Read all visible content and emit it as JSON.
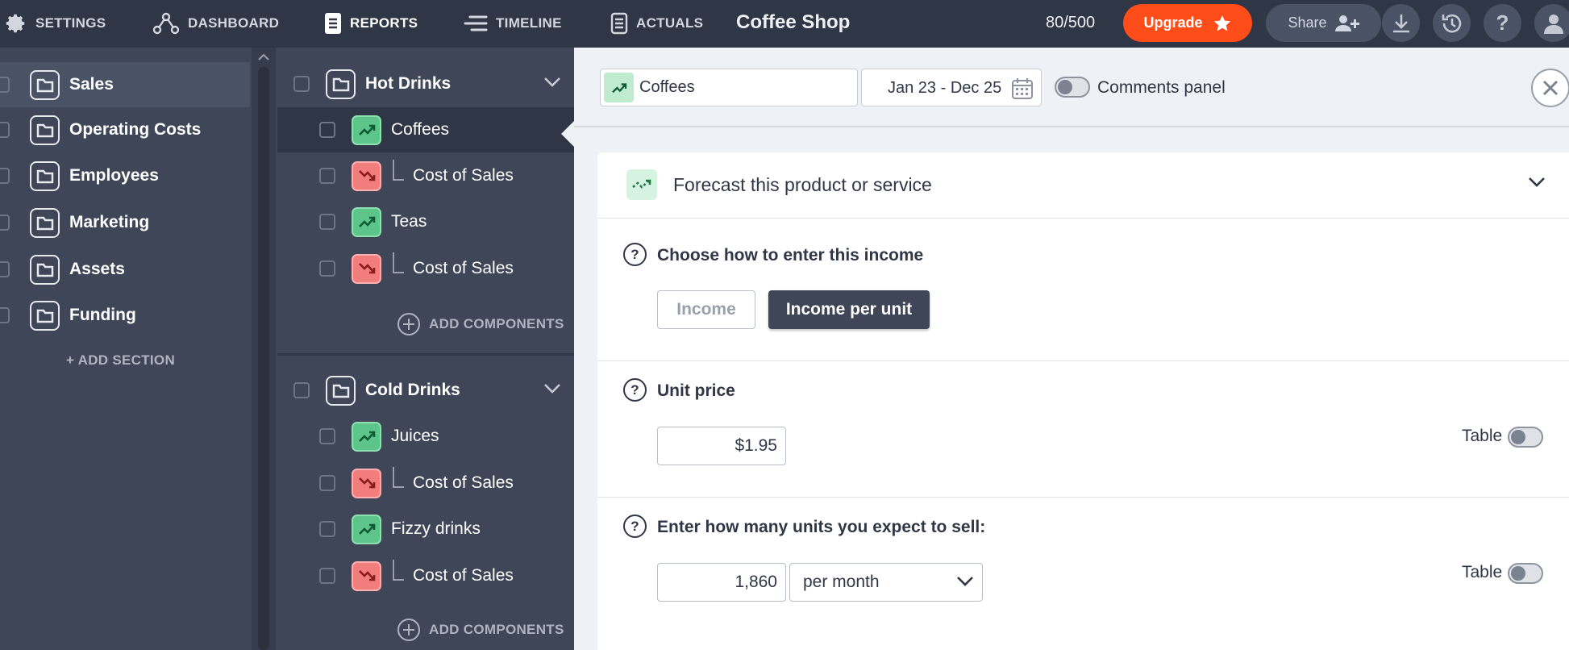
{
  "nav": {
    "settings": "SETTINGS",
    "dashboard": "DASHBOARD",
    "reports": "REPORTS",
    "timeline": "TIMELINE",
    "actuals": "ACTUALS"
  },
  "header": {
    "title": "Coffee Shop",
    "counter": "80/500",
    "upgrade_label": "Upgrade",
    "share_label": "Share"
  },
  "sections": {
    "items": [
      {
        "label": "Sales"
      },
      {
        "label": "Operating Costs"
      },
      {
        "label": "Employees"
      },
      {
        "label": "Marketing"
      },
      {
        "label": "Assets"
      },
      {
        "label": "Funding"
      }
    ],
    "add_label": "+ ADD SECTION"
  },
  "groups": [
    {
      "label": "Hot Drinks",
      "items": [
        {
          "label": "Coffees"
        },
        {
          "label": "Cost of Sales"
        },
        {
          "label": "Teas"
        },
        {
          "label": "Cost of Sales"
        }
      ],
      "add_label": "ADD COMPONENTS"
    },
    {
      "label": "Cold Drinks",
      "items": [
        {
          "label": "Juices"
        },
        {
          "label": "Cost of Sales"
        },
        {
          "label": "Fizzy drinks"
        },
        {
          "label": "Cost of Sales"
        }
      ],
      "add_label": "ADD COMPONENTS"
    }
  ],
  "panel": {
    "selected_item": "Coffees",
    "date_range": "Jan 23 - Dec 25",
    "comments_label": "Comments panel",
    "forecast_title": "Forecast this product or service",
    "income_question": "Choose how to enter this income",
    "option_income": "Income",
    "option_per_unit": "Income per unit",
    "unit_price_label": "Unit price",
    "unit_price_value": "$1.95",
    "units_question": "Enter how many units you expect to sell:",
    "units_value": "1,860",
    "units_period": "per month",
    "table_label": "Table",
    "help_glyph": "?"
  },
  "colors": {
    "topbar": "#2f3645",
    "sidebar": "#3e4657",
    "accent_upgrade": "#ff4d1a",
    "income_green": "#5ec58a",
    "cost_red": "#f27d7d",
    "panel_bg": "#eef1f5"
  },
  "icons": {
    "settings": "gear-icon",
    "dashboard": "nodes-icon",
    "reports": "document-icon",
    "timeline": "timeline-icon",
    "actuals": "list-document-icon",
    "upgrade": "star-icon",
    "share": "add-user-icon",
    "download": "download-icon",
    "history": "history-icon",
    "help": "help-icon",
    "account": "user-icon"
  }
}
